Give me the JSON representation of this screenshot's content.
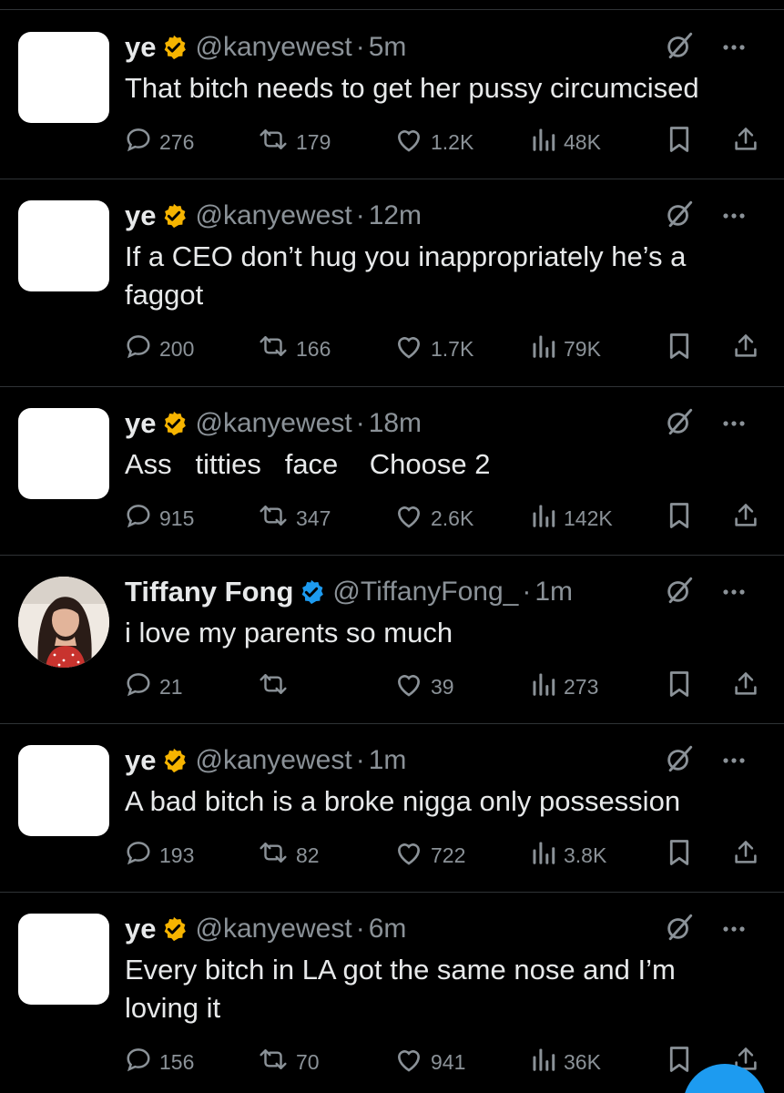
{
  "colors": {
    "background": "#000000",
    "text": "#e7e9ea",
    "muted": "#8b9298",
    "divider": "#2f3336",
    "gold_badge": "#f6b400",
    "blue_badge": "#1d9bf0",
    "fab": "#1d9bf0"
  },
  "icons": [
    "reply-icon",
    "retweet-icon",
    "like-icon",
    "views-icon",
    "bookmark-icon",
    "share-icon",
    "grok-icon",
    "more-icon",
    "verified-badge-icon"
  ],
  "tweets": [
    {
      "name": "ye",
      "handle": "@kanyewest",
      "sep": "·",
      "time": "5m",
      "badge": "gold",
      "text": "That bitch needs to get her pussy circumcised",
      "replies": "276",
      "reposts": "179",
      "likes": "1.2K",
      "views": "48K"
    },
    {
      "name": "ye",
      "handle": "@kanyewest",
      "sep": "·",
      "time": "12m",
      "badge": "gold",
      "text": "If a CEO don’t hug you inappropriately he’s a\nfaggot",
      "replies": "200",
      "reposts": "166",
      "likes": "1.7K",
      "views": "79K"
    },
    {
      "name": "ye",
      "handle": "@kanyewest",
      "sep": "·",
      "time": "18m",
      "badge": "gold",
      "text": "Ass   titties   face    Choose 2",
      "replies": "915",
      "reposts": "347",
      "likes": "2.6K",
      "views": "142K"
    },
    {
      "name": "Tiffany Fong",
      "handle": "@TiffanyFong_",
      "sep": "·",
      "time": "1m",
      "badge": "blue",
      "text": "i love my parents so much",
      "replies": "21",
      "reposts": "",
      "likes": "39",
      "views": "273"
    },
    {
      "name": "ye",
      "handle": "@kanyewest",
      "sep": "·",
      "time": "1m",
      "badge": "gold",
      "text": "A bad bitch is a broke nigga only possession",
      "replies": "193",
      "reposts": "82",
      "likes": "722",
      "views": "3.8K"
    },
    {
      "name": "ye",
      "handle": "@kanyewest",
      "sep": "·",
      "time": "6m",
      "badge": "gold",
      "text": "Every bitch in LA got the same nose and I’m\nloving it",
      "replies": "156",
      "reposts": "70",
      "likes": "941",
      "views": "36K"
    }
  ]
}
